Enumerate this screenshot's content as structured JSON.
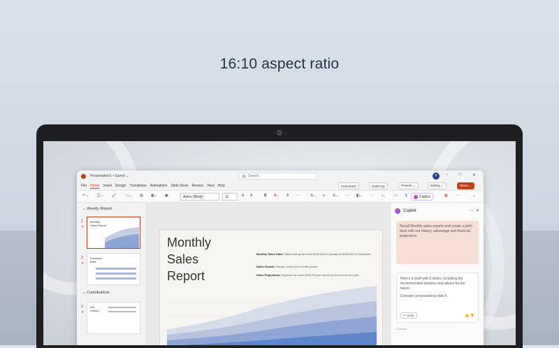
{
  "headline": "16:10 aspect ratio",
  "titlebar": {
    "doc_title": "Presentation1 • Saved ⌄",
    "search_placeholder": "Search",
    "avatar_initial": "P",
    "minimize": "–",
    "maximize": "□",
    "close": "✕"
  },
  "menu": {
    "items": [
      "File",
      "Home",
      "Insert",
      "Design",
      "Transitions",
      "Animations",
      "Slide Show",
      "Review",
      "View",
      "Help"
    ],
    "active": "Home",
    "comments": "Comments",
    "catch_up": "Catch Up",
    "present": "Present ⌄",
    "editing": "Editing ⌄",
    "share": "Share ⌄"
  },
  "ribbon": {
    "font_name": "Aptos (Body)",
    "font_size": "11",
    "bold": "B",
    "copilot": "Copilot"
  },
  "sections": {
    "weekly_report": "⌄ Weekly Report",
    "contributions": "⌄ Contributions"
  },
  "thumbnails": [
    {
      "num": "1",
      "text": "Monthly Sales Report"
    },
    {
      "num": "2",
      "text": "Executive Brief"
    },
    {
      "num": "3",
      "text": "Our History"
    }
  ],
  "slide": {
    "title_line1": "Monthly",
    "title_line2": "Sales",
    "title_line3": "Report",
    "b1_label": "Monthly Sales Data:",
    "b1_text": " Sales have grown from $100,000 in January to $180,000 in December",
    "b2_label": "Sales Growth:",
    "b2_text": " Steady month-over-month growth",
    "b3_label": "Sales Projections:",
    "b3_text": " Expected to reach $200,000 per month by the end of next year",
    "chart_colors": [
      "#d7dcea",
      "#b8c3de",
      "#8fa5d3",
      "#5e86c8"
    ]
  },
  "copilot": {
    "title": "Copilot",
    "user_prompt": "Recall Monthly sales reports and create a pitch deck with our history, advantage and  financial projections.",
    "reply_line1": "Here's a draft with 5 slides, including the recommended sections and advice for the future.",
    "reply_line2": "Consider personalizing slide 5.",
    "undo": "↶ Undo",
    "feedback": "👍 👎",
    "footer": "Contoso"
  }
}
